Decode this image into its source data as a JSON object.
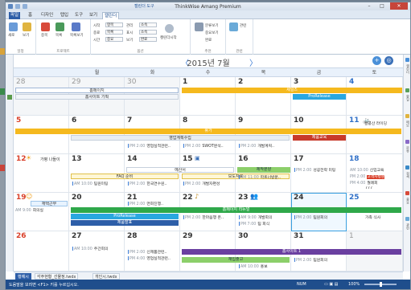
{
  "app": {
    "title": "ThinkWise Amang Premium",
    "context_tab": "캘린더 도구"
  },
  "ribbon_tabs": [
    "파일",
    "홈",
    "디자인",
    "탭입",
    "도구",
    "보기",
    "캘린더"
  ],
  "ribbon": {
    "groups": [
      "일정",
      "프로젝트",
      "옵션",
      "추천",
      "관련"
    ],
    "items": [
      "새로",
      "보기",
      "오늘",
      "이동",
      "중목",
      "목록",
      "목록보기",
      "시작",
      "관리",
      "종료",
      "표시",
      "시간",
      "보기",
      "일정",
      "인쇄",
      "자료",
      "한주",
      "관련",
      "캘린더시작",
      "분류보기",
      "중요보기",
      "완료",
      "관련"
    ],
    "selects": [
      "항목",
      "목록",
      "소속",
      "소속",
      "중요",
      "완료"
    ]
  },
  "nav": {
    "month": "2015년 7월",
    "prev": "〈",
    "next": "〉",
    "add": "+",
    "today": "◎"
  },
  "dow": [
    "월",
    "화",
    "수",
    "목",
    "금",
    "토"
  ],
  "weeks": [
    {
      "days": [
        "28",
        "29",
        "30",
        "1",
        "2",
        "3",
        "4"
      ]
    },
    {
      "days": [
        "5",
        "6",
        "7",
        "8",
        "9",
        "10",
        "11"
      ]
    },
    {
      "days": [
        "12",
        "13",
        "14",
        "15",
        "16",
        "17",
        "18"
      ]
    },
    {
      "days": [
        "19",
        "20",
        "21",
        "22",
        "23",
        "24",
        "25"
      ]
    },
    {
      "days": [
        "26",
        "27",
        "28",
        "29",
        "30",
        "31",
        "1"
      ]
    }
  ],
  "holidays": {
    "w0": "",
    "w1": "",
    "w2": "가평 나들이",
    "w3": "",
    "w4": ""
  },
  "bars": {
    "w0": [
      "홈페이지",
      "홈사이트 기획",
      "세일즈",
      "ProRelease"
    ],
    "w1": [
      "휴가",
      "영업계획수립",
      "제품교육"
    ],
    "w2": [
      "FAQ 준비",
      "예산서",
      "보도자료",
      "제작분양"
    ],
    "w3": [
      "재택근무",
      "ProRelease",
      "제품발표",
      "홈페이지 리뉴얼"
    ],
    "w4": [
      "재입출고",
      "홈사이트 1"
    ]
  },
  "events": {
    "w0": [],
    "w1": [
      {
        "time": "PM 2:00",
        "text": "영업실적관련.."
      },
      {
        "time": "PM 2:00",
        "text": "SWOT분석.."
      },
      {
        "time": "",
        "text": "팔공산 라이딩"
      },
      {
        "time": "PM 2:00",
        "text": "개발계획.."
      }
    ],
    "w2": [
      {
        "time": "AM 10:00",
        "text": "팀원미팅"
      },
      {
        "time": "PM 2:00",
        "text": "한국연수원.."
      },
      {
        "time": "PM 2:00",
        "text": "개발자편성"
      },
      {
        "time": "AM 11:00",
        "text": "파트너방문.."
      },
      {
        "time": "PM 2:00",
        "text": "성공전략 미팅"
      },
      {
        "time": "AM 10:00",
        "text": "신입교육"
      },
      {
        "time": "PM 2:00",
        "text": "고객사방문"
      },
      {
        "time": "PM 4:00",
        "text": "월례회"
      },
      {
        "time": "",
        "text": "777"
      }
    ],
    "w3": [
      {
        "time": "AM 9:00",
        "text": "회의실"
      },
      {
        "time": "PM 2:00",
        "text": "면회진행.."
      },
      {
        "time": "PM 2:00",
        "text": "한마음행 온.."
      },
      {
        "time": "AM 9:00",
        "text": "개발회의"
      },
      {
        "time": "PM 7:00",
        "text": "팀 회식"
      },
      {
        "time": "PM 2:00",
        "text": "팀원회의"
      },
      {
        "time": "",
        "text": "가족 식사"
      }
    ],
    "w4": [
      {
        "time": "AM 10:00",
        "text": "주간회의"
      },
      {
        "time": "PM 2:00",
        "text": "신제품관련.."
      },
      {
        "time": "PM 4:00",
        "text": "영업실적관련.."
      },
      {
        "time": "AM 10:00",
        "text": "홍보"
      },
      {
        "time": "PM 2:00",
        "text": "팀원회의"
      }
    ]
  },
  "right_panel": [
    "캘린더",
    "할일",
    "메모",
    "분류",
    "검색",
    "중요",
    "관련"
  ],
  "calendar_tabs": [
    "행예시",
    "각주현황_선물정.twdx",
    "개인시.twdx"
  ],
  "status": {
    "left": "도움말을 보려면 <F1> 키를 누르십시오.",
    "mode": "NUM",
    "zoom": "100%"
  }
}
